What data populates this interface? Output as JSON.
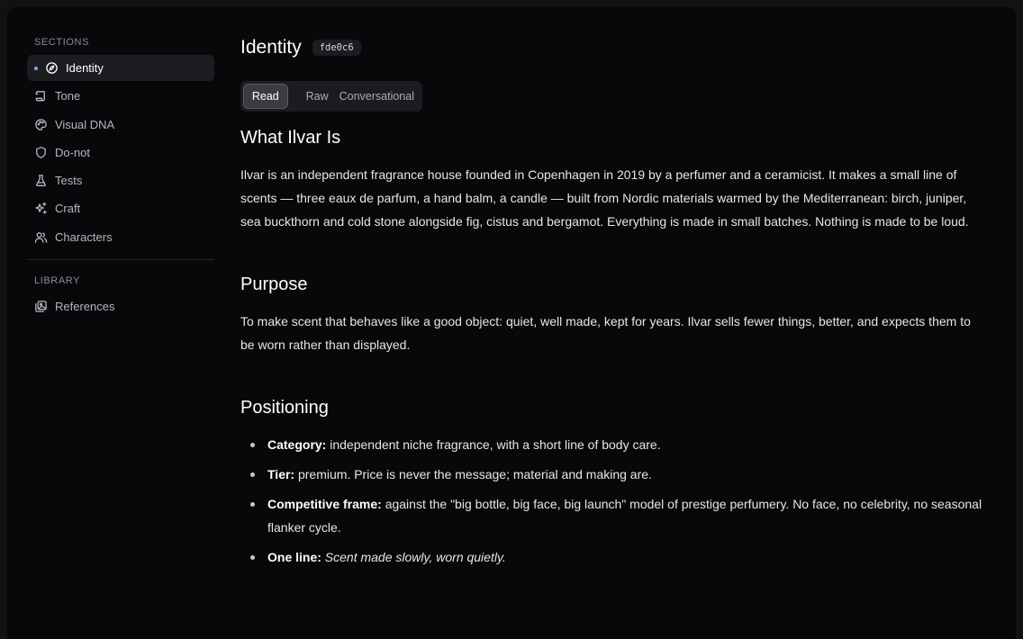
{
  "sidebar": {
    "sections_label": "SECTIONS",
    "items": [
      {
        "label": "Identity",
        "icon": "compass-icon",
        "active": true
      },
      {
        "label": "Tone",
        "icon": "scroll-icon"
      },
      {
        "label": "Visual DNA",
        "icon": "palette-icon"
      },
      {
        "label": "Do-not",
        "icon": "shield-icon"
      },
      {
        "label": "Tests",
        "icon": "flask-icon"
      },
      {
        "label": "Craft",
        "icon": "sparkles-icon"
      },
      {
        "label": "Characters",
        "icon": "users-icon"
      }
    ],
    "library_label": "LIBRARY",
    "library_items": [
      {
        "label": "References",
        "icon": "images-icon"
      }
    ],
    "active_dot_color": "#8fa2ff"
  },
  "main": {
    "title": "Identity",
    "hash": "fde0c6",
    "tabs": [
      {
        "label": "Read",
        "active": true
      },
      {
        "label": "Raw"
      },
      {
        "label": "Conversational"
      }
    ],
    "sections": {
      "what": {
        "heading": "What Ilvar Is",
        "body": "Ilvar is an independent fragrance house founded in Copenhagen in 2019 by a perfumer and a ceramicist. It makes a small line of scents — three eaux de parfum, a hand balm, a candle — built from Nordic materials warmed by the Mediterranean: birch, juniper, sea buckthorn and cold stone alongside fig, cistus and bergamot. Everything is made in small batches. Nothing is made to be loud."
      },
      "purpose": {
        "heading": "Purpose",
        "body": "To make scent that behaves like a good object: quiet, well made, kept for years. Ilvar sells fewer things, better, and expects them to be worn rather than displayed."
      },
      "positioning": {
        "heading": "Positioning",
        "items": [
          {
            "label": "Category:",
            "text": " independent niche fragrance, with a short line of body care."
          },
          {
            "label": "Tier:",
            "text": " premium. Price is never the message; material and making are."
          },
          {
            "label": "Competitive frame:",
            "text": " against the \"big bottle, big face, big launch\" model of prestige perfumery. No face, no celebrity, no seasonal flanker cycle."
          },
          {
            "label": "One line:",
            "text": "Scent made slowly, worn quietly."
          }
        ]
      }
    }
  }
}
